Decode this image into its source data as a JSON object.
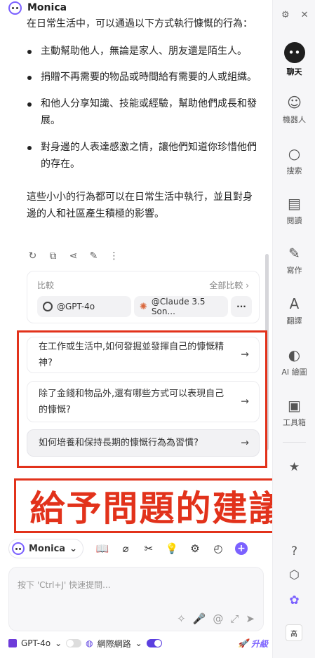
{
  "header": {
    "app_name": "Monica"
  },
  "message": {
    "intro": "在日常生活中，可以通過以下方式執行慷慨的行為：",
    "bullets": [
      "主動幫助他人，無論是家人、朋友還是陌生人。",
      "捐贈不再需要的物品或時間給有需要的人或組織。",
      "和他人分享知識、技能或經驗，幫助他們成長和發展。",
      "對身邊的人表達感激之情，讓他們知道你珍惜他們的存在。"
    ],
    "outro": "這些小小的行為都可以在日常生活中執行，並且對身邊的人和社區產生積極的影響。"
  },
  "compare": {
    "label": "比較",
    "all_label": "全部比較 ›",
    "models": [
      "@GPT-4o",
      "@Claude 3.5 Son..."
    ],
    "more_label": "···"
  },
  "suggestions": [
    "在工作或生活中,如何發掘並發揮自己的慷慨精神?",
    "除了金錢和物品外,還有哪些方式可以表現自己的慷慨?",
    "如何培養和保持長期的慷慨行為為習慣?"
  ],
  "banner": {
    "text": "給予問題的建議"
  },
  "composer": {
    "model_name": "Monica",
    "placeholder": "按下 'Ctrl+J' 快速提問...",
    "footer_model": "GPT-4o",
    "web_label": "網際網路",
    "upgrade_label": "升級"
  },
  "sidebar": {
    "items": [
      {
        "label": "聊天",
        "icon": "chat-icon"
      },
      {
        "label": "機器人",
        "icon": "robot-icon"
      },
      {
        "label": "搜索",
        "icon": "search-icon"
      },
      {
        "label": "閱讀",
        "icon": "read-icon"
      },
      {
        "label": "寫作",
        "icon": "write-icon"
      },
      {
        "label": "翻譯",
        "icon": "translate-icon"
      },
      {
        "label": "AI 繪圖",
        "icon": "paint-icon"
      },
      {
        "label": "工具箱",
        "icon": "toolbox-icon"
      }
    ],
    "avatar_text": "高"
  },
  "colors": {
    "accent": "#7b61ff",
    "highlight": "#e2321b",
    "sidebar_bg": "#f6f6f8"
  }
}
